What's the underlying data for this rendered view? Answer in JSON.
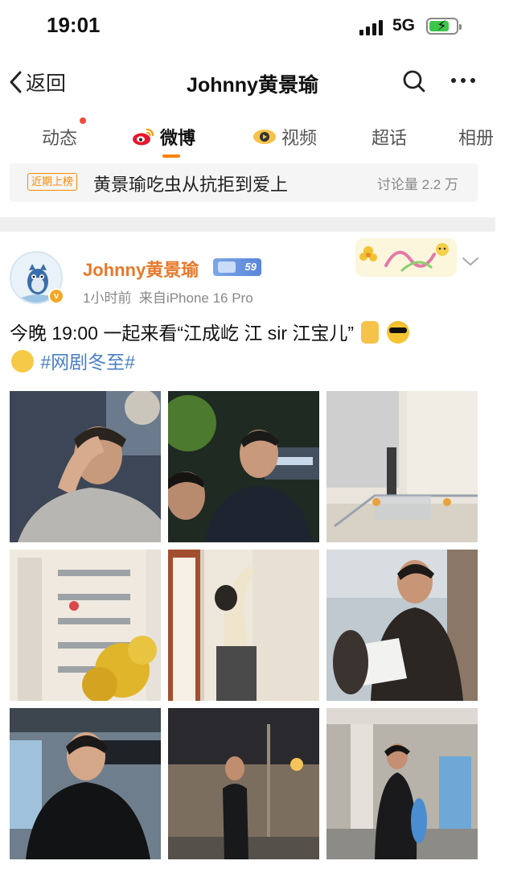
{
  "status_bar": {
    "time": "19:01",
    "network": "5G"
  },
  "nav": {
    "back_label": "返回",
    "title": "Johnny黄景瑜"
  },
  "tabs": [
    {
      "label": "动态"
    },
    {
      "label": "微博"
    },
    {
      "label": "视频"
    },
    {
      "label": "超话"
    },
    {
      "label": "相册"
    }
  ],
  "trending": {
    "badge": "近期上榜",
    "text": "黄景瑜吃虫从抗拒到爱上",
    "count": "讨论量 2.2 万"
  },
  "post": {
    "author": "Johnny黄景瑜",
    "vip_level": "59",
    "time": "1小时前",
    "source": "来自iPhone 16 Pro",
    "text_main": "今晚 19:00  一起来看“江成屹 江 sir 江宝儿”",
    "hashtag": "#网剧冬至#",
    "images": [
      {
        "name": "photo-man-hand-on-head"
      },
      {
        "name": "photo-man-night-street"
      },
      {
        "name": "photo-stairs-building"
      },
      {
        "name": "photo-apartment-tree"
      },
      {
        "name": "photo-man-climbing-wall"
      },
      {
        "name": "photo-man-reading-script"
      },
      {
        "name": "photo-man-black-jacket"
      },
      {
        "name": "photo-man-on-phone-night"
      },
      {
        "name": "photo-man-walking-lobby"
      }
    ]
  },
  "colors": {
    "accent": "#ff8200",
    "author": "#e8782a",
    "hashtag": "#4a7fc6",
    "badge": "#ff8a00"
  }
}
